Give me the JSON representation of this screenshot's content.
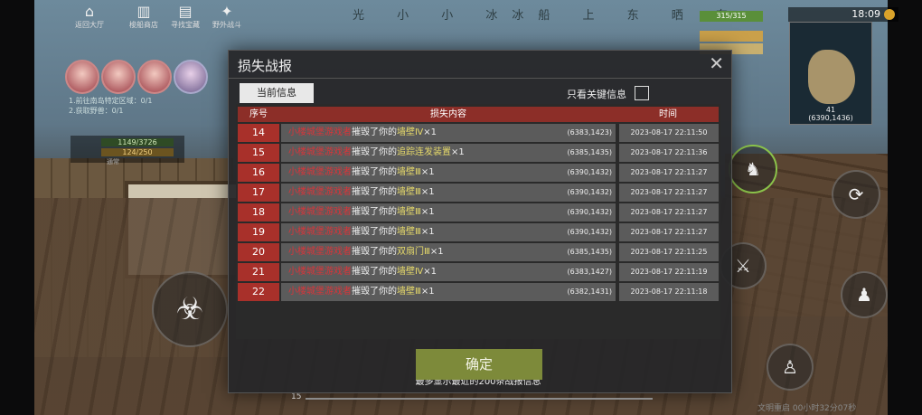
{
  "hud": {
    "top_buttons": [
      {
        "name": "return-home-button",
        "label": "返回大厅"
      },
      {
        "name": "boat-build-button",
        "label": "梭船商店"
      },
      {
        "name": "exploration-button",
        "label": "寻找宝藏"
      },
      {
        "name": "wild-button",
        "label": "野外战斗"
      }
    ],
    "banner": "光   小 小 冰冰船 上 东 晒 东",
    "quest_lines": [
      "1.前往南岛特定区域：0/1",
      "2.获取野兽：0/1"
    ],
    "bar_values": [
      "1149/3726",
      "124/250"
    ],
    "bar_caption": "通常",
    "hp": "315/315",
    "clock": "18:09",
    "minimap_coords": "(6390,1436)",
    "minimap_level": "41",
    "bottom_info": "文明重启 00小时32分07秒",
    "slider_value": "15"
  },
  "dialog": {
    "title": "损失战报",
    "close_symbol": "✕",
    "tab_current": "当前信息",
    "key_only_label": "只看关键信息",
    "columns": [
      "序号",
      "损失内容",
      "时间"
    ],
    "rows": [
      {
        "num": "14",
        "player": "小楼城堡游戏者",
        "verb": "摧毁了你的",
        "item": "墙壁Ⅳ",
        "qty": "×1",
        "coord": "(6383,1423)",
        "time": "2023-08-17 22:11:50"
      },
      {
        "num": "15",
        "player": "小楼城堡游戏者",
        "verb": "摧毁了你的",
        "item": "追踪连发装置",
        "qty": "×1",
        "coord": "(6385,1435)",
        "time": "2023-08-17 22:11:36"
      },
      {
        "num": "16",
        "player": "小楼城堡游戏者",
        "verb": "摧毁了你的",
        "item": "墙壁Ⅲ",
        "qty": "×1",
        "coord": "(6390,1432)",
        "time": "2023-08-17 22:11:27"
      },
      {
        "num": "17",
        "player": "小楼城堡游戏者",
        "verb": "摧毁了你的",
        "item": "墙壁Ⅲ",
        "qty": "×1",
        "coord": "(6390,1432)",
        "time": "2023-08-17 22:11:27"
      },
      {
        "num": "18",
        "player": "小楼城堡游戏者",
        "verb": "摧毁了你的",
        "item": "墙壁Ⅲ",
        "qty": "×1",
        "coord": "(6390,1432)",
        "time": "2023-08-17 22:11:27"
      },
      {
        "num": "19",
        "player": "小楼城堡游戏者",
        "verb": "摧毁了你的",
        "item": "墙壁Ⅲ",
        "qty": "×1",
        "coord": "(6390,1432)",
        "time": "2023-08-17 22:11:27"
      },
      {
        "num": "20",
        "player": "小楼城堡游戏者",
        "verb": "摧毁了你的",
        "item": "双扇门Ⅲ",
        "qty": "×1",
        "coord": "(6385,1435)",
        "time": "2023-08-17 22:11:25"
      },
      {
        "num": "21",
        "player": "小楼城堡游戏者",
        "verb": "摧毁了你的",
        "item": "墙壁Ⅳ",
        "qty": "×1",
        "coord": "(6383,1427)",
        "time": "2023-08-17 22:11:19"
      },
      {
        "num": "22",
        "player": "小楼城堡游戏者",
        "verb": "摧毁了你的",
        "item": "墙壁Ⅲ",
        "qty": "×1",
        "coord": "(6382,1431)",
        "time": "2023-08-17 22:11:18"
      }
    ],
    "footnote": "最多显示最近的200条战报信息",
    "confirm_label": "确定"
  },
  "colors": {
    "header_red": "#8c2e28",
    "num_red": "#a8302a",
    "player_red": "#d8353a",
    "item_yellow": "#e6d96a",
    "confirm_green": "#7d8a3a"
  }
}
